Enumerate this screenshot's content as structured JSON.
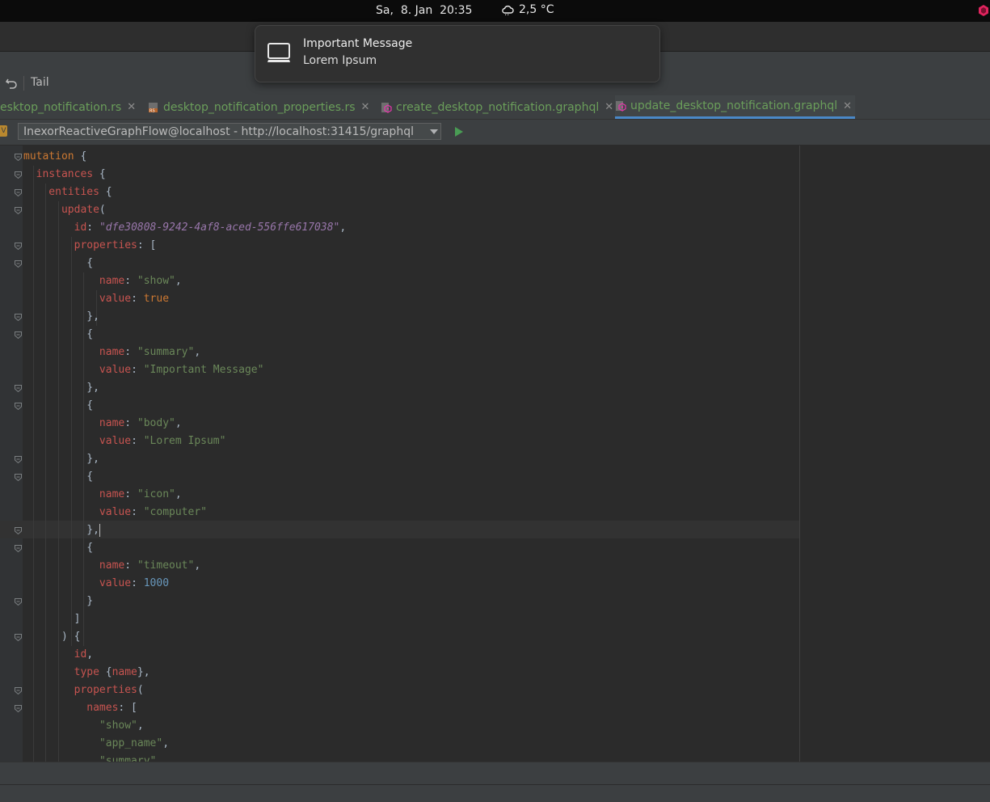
{
  "system_bar": {
    "clock": "Sa,  8. Jan  20:35",
    "temperature": "2,5 °C"
  },
  "notification": {
    "icon": "computer-icon",
    "title": "Important Message",
    "body": "Lorem Ipsum"
  },
  "toolbar": {
    "undo_icon": "undo-icon",
    "tail_label": "Tail"
  },
  "tabs": [
    {
      "label": "esktop_notification.rs",
      "active": false
    },
    {
      "label": "desktop_notification_properties.rs",
      "active": false
    },
    {
      "label": "create_desktop_notification.graphql",
      "active": false
    },
    {
      "label": "update_desktop_notification.graphql",
      "active": true
    }
  ],
  "connection": {
    "badge": "V",
    "endpoint": "InexorReactiveGraphFlow@localhost - http://localhost:31415/graphql",
    "run_icon": "play-icon"
  },
  "code_lines": [
    [
      {
        "t": "mutation",
        "c": "kw"
      },
      {
        "t": " {",
        "c": ""
      }
    ],
    [
      {
        "t": "  instances",
        "c": "fn"
      },
      {
        "t": " {",
        "c": ""
      }
    ],
    [
      {
        "t": "    entities",
        "c": "fn"
      },
      {
        "t": " {",
        "c": ""
      }
    ],
    [
      {
        "t": "      update",
        "c": "fn"
      },
      {
        "t": "(",
        "c": ""
      }
    ],
    [
      {
        "t": "        id",
        "c": "fn"
      },
      {
        "t": ": ",
        "c": ""
      },
      {
        "t": "\"dfe30808-9242-4af8-aced-556ffe617038\"",
        "c": "idstr"
      },
      {
        "t": ",",
        "c": ""
      }
    ],
    [
      {
        "t": "        properties",
        "c": "fn"
      },
      {
        "t": ": [",
        "c": ""
      }
    ],
    [
      {
        "t": "          {",
        "c": ""
      }
    ],
    [
      {
        "t": "            name",
        "c": "fn"
      },
      {
        "t": ": ",
        "c": ""
      },
      {
        "t": "\"show\"",
        "c": "str"
      },
      {
        "t": ",",
        "c": ""
      }
    ],
    [
      {
        "t": "            value",
        "c": "fn"
      },
      {
        "t": ": ",
        "c": ""
      },
      {
        "t": "true",
        "c": "kw"
      }
    ],
    [
      {
        "t": "          },",
        "c": ""
      }
    ],
    [
      {
        "t": "          {",
        "c": ""
      }
    ],
    [
      {
        "t": "            name",
        "c": "fn"
      },
      {
        "t": ": ",
        "c": ""
      },
      {
        "t": "\"summary\"",
        "c": "str"
      },
      {
        "t": ",",
        "c": ""
      }
    ],
    [
      {
        "t": "            value",
        "c": "fn"
      },
      {
        "t": ": ",
        "c": ""
      },
      {
        "t": "\"Important Message\"",
        "c": "str"
      }
    ],
    [
      {
        "t": "          },",
        "c": ""
      }
    ],
    [
      {
        "t": "          {",
        "c": ""
      }
    ],
    [
      {
        "t": "            name",
        "c": "fn"
      },
      {
        "t": ": ",
        "c": ""
      },
      {
        "t": "\"body\"",
        "c": "str"
      },
      {
        "t": ",",
        "c": ""
      }
    ],
    [
      {
        "t": "            value",
        "c": "fn"
      },
      {
        "t": ": ",
        "c": ""
      },
      {
        "t": "\"Lorem Ipsum\"",
        "c": "str"
      }
    ],
    [
      {
        "t": "          },",
        "c": ""
      }
    ],
    [
      {
        "t": "          {",
        "c": ""
      }
    ],
    [
      {
        "t": "            name",
        "c": "fn"
      },
      {
        "t": ": ",
        "c": ""
      },
      {
        "t": "\"icon\"",
        "c": "str"
      },
      {
        "t": ",",
        "c": ""
      }
    ],
    [
      {
        "t": "            value",
        "c": "fn"
      },
      {
        "t": ": ",
        "c": ""
      },
      {
        "t": "\"computer\"",
        "c": "str"
      }
    ],
    [
      {
        "t": "          },",
        "c": ""
      },
      {
        "t": "",
        "c": "caret"
      }
    ],
    [
      {
        "t": "          {",
        "c": ""
      }
    ],
    [
      {
        "t": "            name",
        "c": "fn"
      },
      {
        "t": ": ",
        "c": ""
      },
      {
        "t": "\"timeout\"",
        "c": "str"
      },
      {
        "t": ",",
        "c": ""
      }
    ],
    [
      {
        "t": "            value",
        "c": "fn"
      },
      {
        "t": ": ",
        "c": ""
      },
      {
        "t": "1000",
        "c": "num"
      }
    ],
    [
      {
        "t": "          }",
        "c": ""
      }
    ],
    [
      {
        "t": "        ]",
        "c": ""
      }
    ],
    [
      {
        "t": "      ) {",
        "c": ""
      }
    ],
    [
      {
        "t": "        id",
        "c": "fn"
      },
      {
        "t": ",",
        "c": ""
      }
    ],
    [
      {
        "t": "        type",
        "c": "fn"
      },
      {
        "t": " {",
        "c": ""
      },
      {
        "t": "name",
        "c": "fn"
      },
      {
        "t": "},",
        "c": ""
      }
    ],
    [
      {
        "t": "        properties",
        "c": "fn"
      },
      {
        "t": "(",
        "c": ""
      }
    ],
    [
      {
        "t": "          names",
        "c": "fn"
      },
      {
        "t": ": [",
        "c": ""
      }
    ],
    [
      {
        "t": "            \"show\"",
        "c": "str"
      },
      {
        "t": ",",
        "c": ""
      }
    ],
    [
      {
        "t": "            \"app_name\"",
        "c": "str"
      },
      {
        "t": ",",
        "c": ""
      }
    ],
    [
      {
        "t": "            \"summary\"",
        "c": "str"
      },
      {
        "t": ",",
        "c": ""
      }
    ]
  ]
}
